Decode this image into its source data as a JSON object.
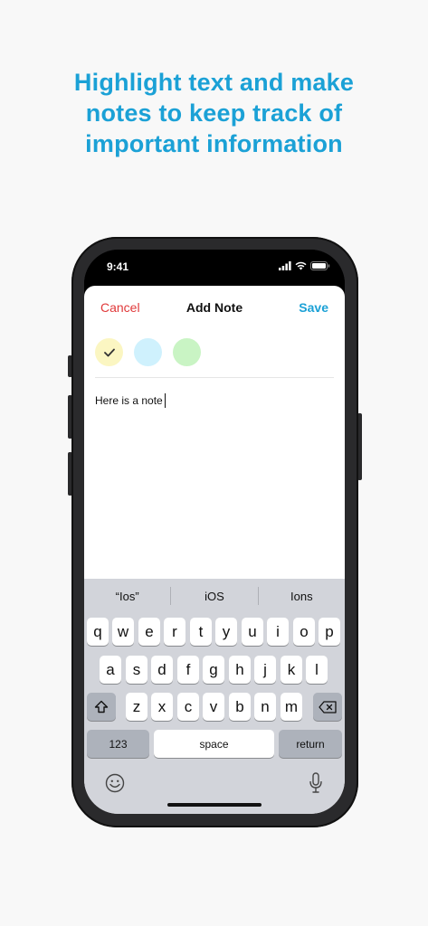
{
  "headline": {
    "line1": "Highlight text and make",
    "line2": "notes to keep track of",
    "line3": "important information"
  },
  "status_bar": {
    "time": "9:41"
  },
  "sheet": {
    "cancel": "Cancel",
    "title": "Add Note",
    "save": "Save",
    "swatches": [
      {
        "color": "#fbf6c2",
        "selected": true
      },
      {
        "color": "#cff1fd",
        "selected": false
      },
      {
        "color": "#c9f4c4",
        "selected": false
      }
    ],
    "note_value": "Here is a note"
  },
  "keyboard": {
    "suggestions": [
      "“Ios”",
      "iOS",
      "Ions"
    ],
    "row1": [
      "q",
      "w",
      "e",
      "r",
      "t",
      "y",
      "u",
      "i",
      "o",
      "p"
    ],
    "row2": [
      "a",
      "s",
      "d",
      "f",
      "g",
      "h",
      "j",
      "k",
      "l"
    ],
    "row3": [
      "z",
      "x",
      "c",
      "v",
      "b",
      "n",
      "m"
    ],
    "numbers_key": "123",
    "space_key": "space",
    "return_key": "return"
  },
  "colors": {
    "accent": "#1ba1d6",
    "cancel": "#e0393a",
    "keyboard_bg": "#d2d4da"
  }
}
